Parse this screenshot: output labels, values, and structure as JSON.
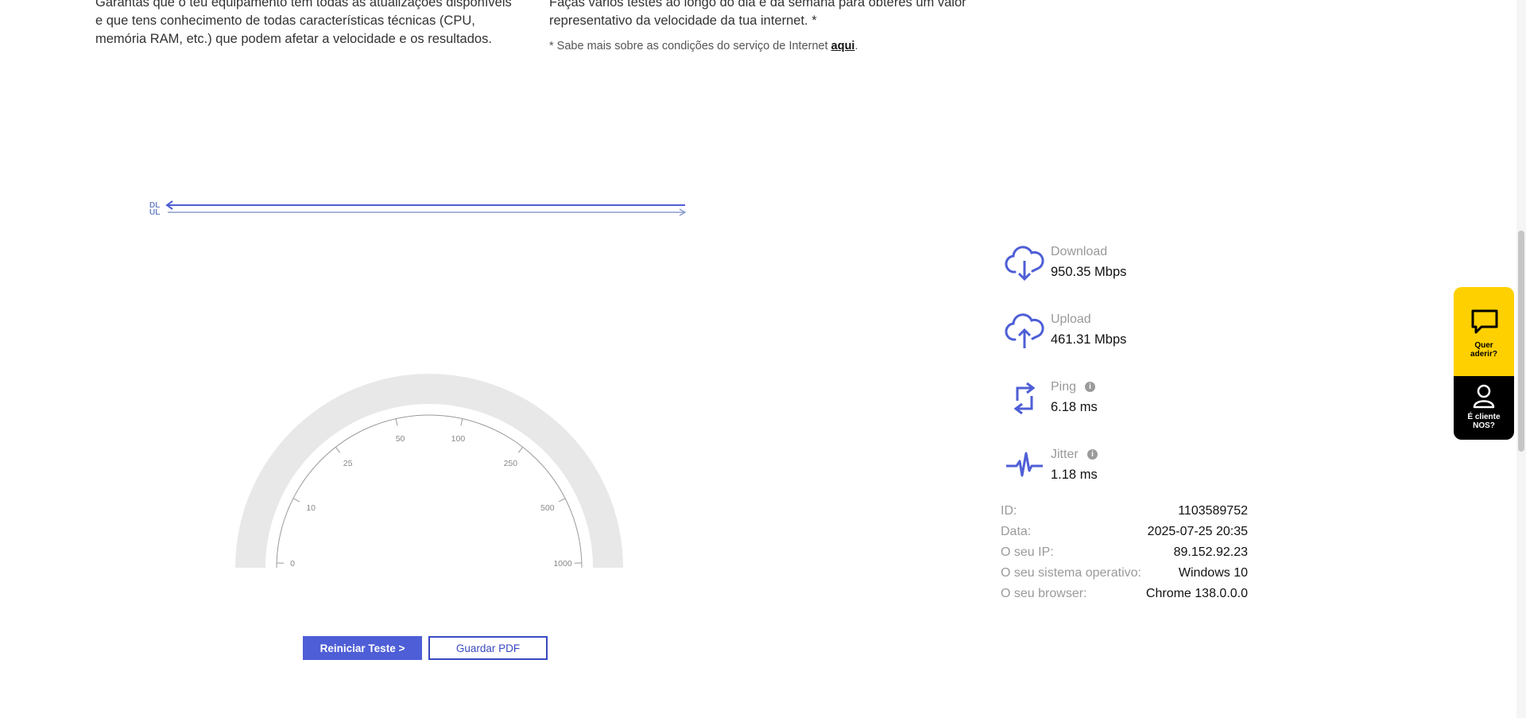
{
  "intro": {
    "left_text": "Garantas que o teu equipamento tem todas as atualizações disponíveis\ne que tens conhecimento de todas características técnicas (CPU,\nmemória RAM, etc.) que podem afetar a velocidade e os resultados.",
    "right_text": "Faças vários testes ao longo do dia e da semana para obteres um valor\nrepresentativo da velocidade da tua internet. *",
    "service_note_prefix": "* Sabe mais sobre as condições do serviço de Internet",
    "service_note_link": "aqui",
    "service_note_suffix": "."
  },
  "graph_legend": {
    "dl": "DL",
    "ul": "UL"
  },
  "gauge": {
    "ticks": [
      "0",
      "10",
      "25",
      "50",
      "100",
      "250",
      "500",
      "1000"
    ],
    "needle_value": 0
  },
  "buttons": {
    "restart": "Reiniciar Teste >",
    "pdf": "Guardar PDF"
  },
  "metrics": [
    {
      "label": "Download",
      "value": "950.35 Mbps",
      "icon": "cloud-download-icon"
    },
    {
      "label": "Upload",
      "value": "461.31 Mbps",
      "icon": "cloud-upload-icon"
    },
    {
      "label": "Ping",
      "value": "6.18 ms",
      "icon": "ping-arrows-icon",
      "info": "i"
    },
    {
      "label": "Jitter",
      "value": "1.18 ms",
      "icon": "jitter-pulse-icon",
      "info": "i"
    }
  ],
  "info": [
    {
      "label": "ID:",
      "value": "1103589752"
    },
    {
      "label": "Data:",
      "value": "2025-07-25 20:35"
    },
    {
      "label": "O seu IP:",
      "value": "89.152.92.23"
    },
    {
      "label": "O seu sistema operativo:",
      "value": "Windows 10"
    },
    {
      "label": "O seu browser:",
      "value": "Chrome 138.0.0.0"
    }
  ],
  "side_widget": {
    "join_label": "Quer\naderir?",
    "client_label": "É cliente\nNOS?"
  },
  "colors": {
    "accent": "#4e5ed6",
    "widget_yellow": "#ffd000",
    "gauge_track": "#e8e8e8"
  }
}
